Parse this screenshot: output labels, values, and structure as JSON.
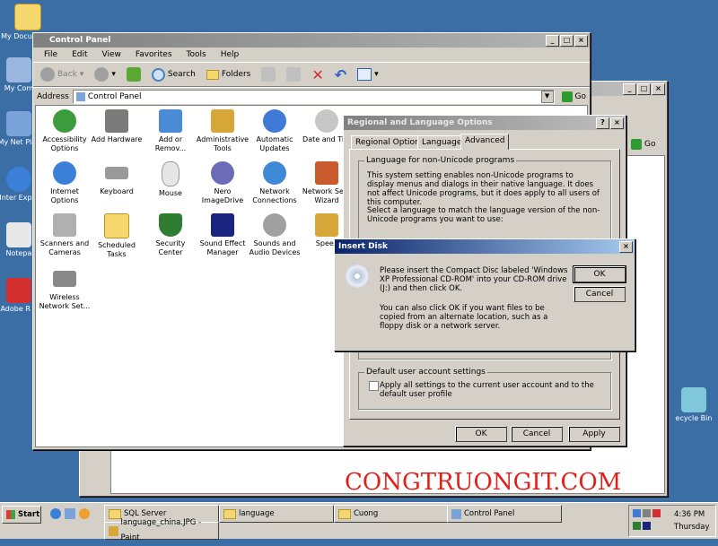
{
  "desktop": {
    "icons": [
      {
        "label": "My Documents",
        "color": "#f5d76e"
      },
      {
        "label": "My Com",
        "color": "#9bb7e0"
      },
      {
        "label": "My Net Plac",
        "color": "#7aa3d9"
      },
      {
        "label": "Inter Explo",
        "color": "#3b7fd6"
      },
      {
        "label": "Notepa",
        "color": "#e8e8e8"
      },
      {
        "label": "Adobe R 8",
        "color": "#d32f2f"
      }
    ],
    "recycle_bin_label": "ecycle Bin"
  },
  "control_panel": {
    "title": "Control Panel",
    "menu": [
      "File",
      "Edit",
      "View",
      "Favorites",
      "Tools",
      "Help"
    ],
    "toolbar": {
      "back": "Back",
      "search": "Search",
      "folders": "Folders"
    },
    "address_label": "Address",
    "address_value": "Control Panel",
    "go_label": "Go",
    "items": [
      {
        "label": "Accessibility Options",
        "color": "#3c9b3c"
      },
      {
        "label": "Add Hardware",
        "color": "#7a7a7a"
      },
      {
        "label": "Add or Remov...",
        "color": "#4a8bd6"
      },
      {
        "label": "Administrative Tools",
        "color": "#d8a73a"
      },
      {
        "label": "Automatic Updates",
        "color": "#3e7ad6"
      },
      {
        "label": "Date and Tim",
        "color": "#c7c7c7"
      },
      {
        "label": "Internet Options",
        "color": "#3b7fd6"
      },
      {
        "label": "Keyboard",
        "color": "#9a9a9a"
      },
      {
        "label": "Mouse",
        "color": "#e6e6e6"
      },
      {
        "label": "Nero ImageDrive",
        "color": "#6b6bb8"
      },
      {
        "label": "Network Connections",
        "color": "#3e8ad6"
      },
      {
        "label": "Network Setu Wizard",
        "color": "#c95b2d"
      },
      {
        "label": "Scanners and Cameras",
        "color": "#b0b0b0"
      },
      {
        "label": "Scheduled Tasks",
        "color": "#f5d76e"
      },
      {
        "label": "Security Center",
        "color": "#2e7d32"
      },
      {
        "label": "Sound Effect Manager",
        "color": "#1a237e"
      },
      {
        "label": "Sounds and Audio Devices",
        "color": "#a0a0a0"
      },
      {
        "label": "Speec",
        "color": "#d8a73a"
      },
      {
        "label": "Wireless Network Set...",
        "color": "#8a8a8a"
      }
    ]
  },
  "regional": {
    "title": "Regional and Language Options",
    "tabs": [
      "Regional Options",
      "Languages",
      "Advanced"
    ],
    "group1_title": "Language for non-Unicode programs",
    "group1_text": "This system setting enables non-Unicode programs to display menus and dialogs in their native language. It does not affect Unicode programs, but it does apply to all users of this computer.",
    "group1_text2": "Select a language to match the language version of the non-Unicode programs you want to use:",
    "group2_title": "Default user account settings",
    "checkbox_label": "Apply all settings to the current user account and to the default user profile",
    "ok": "OK",
    "cancel": "Cancel",
    "apply": "Apply"
  },
  "insert_disk": {
    "title": "Insert Disk",
    "message1": "Please insert the Compact Disc labeled 'Windows XP Professional CD-ROM' into your CD-ROM drive (J:) and then click OK.",
    "message2": "You can also click OK if you want files to be copied from an alternate location, such as a floppy disk or a network server.",
    "ok": "OK",
    "cancel": "Cancel"
  },
  "back_window": {
    "go_label": "Go"
  },
  "watermark": "CONGTRUONGIT.COM",
  "taskbar": {
    "start": "Start",
    "tasks": [
      {
        "label": "SQL Server"
      },
      {
        "label": "language"
      },
      {
        "label": "Cuong"
      },
      {
        "label": "Control Panel"
      },
      {
        "label": "language_china.JPG - Paint"
      }
    ],
    "time": "4:36 PM",
    "day": "Thursday"
  }
}
